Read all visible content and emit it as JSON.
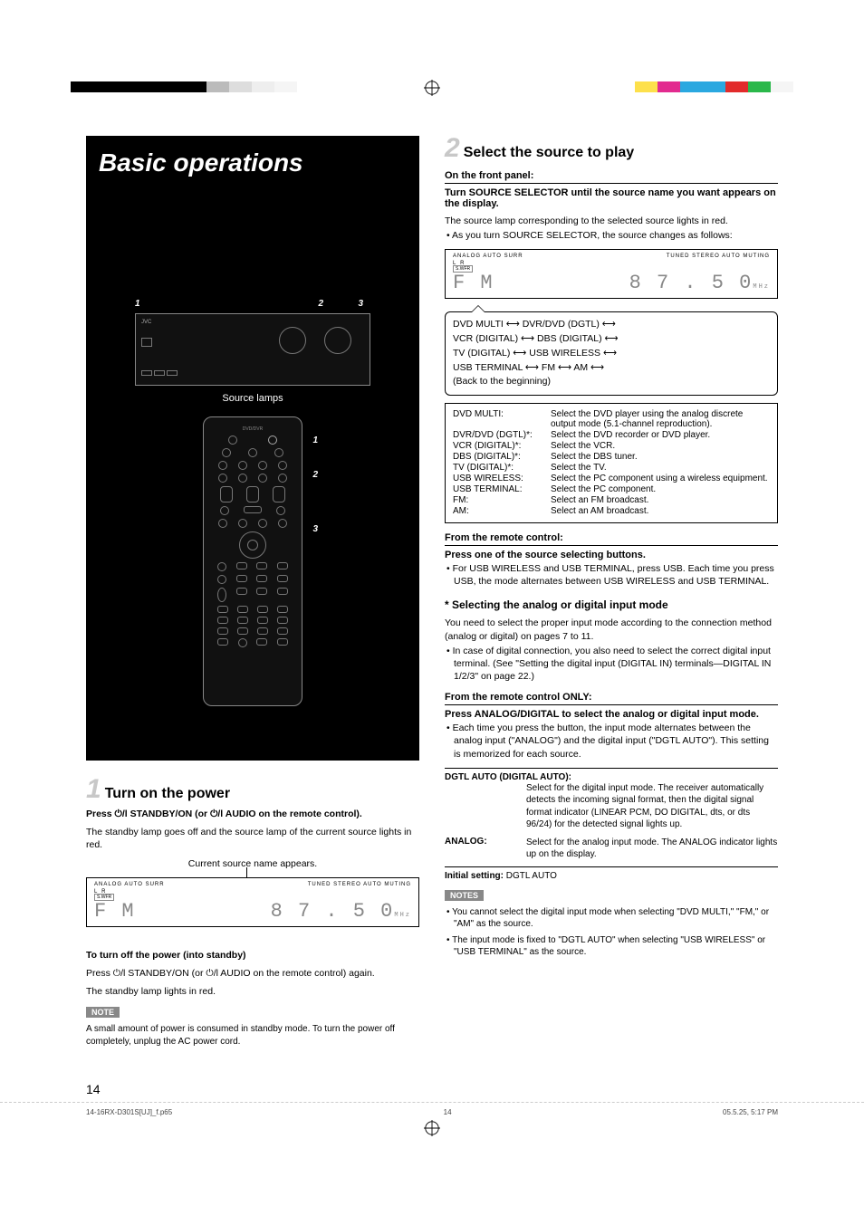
{
  "page_number": "14",
  "banner": {
    "title": "Basic operations"
  },
  "left": {
    "source_lamps_label": "Source lamps",
    "callouts_top": [
      "1",
      "2",
      "3"
    ],
    "callouts_remote": [
      "1",
      "2",
      "3"
    ],
    "step1": {
      "num": "1",
      "title": "Turn on the power",
      "instruction_prefix": "Press ",
      "instruction_mid": " STANDBY/ON (or ",
      "instruction_suffix": " AUDIO on the remote control).",
      "body": "The standby lamp goes off and the source lamp of the current source lights in red.",
      "caption": "Current source name appears.",
      "display": {
        "indicators_left": "ANALOG    AUTO SURR",
        "indicators_right": "TUNED  STEREO  AUTO MUTING",
        "main_left": "F M",
        "main_right": "8 7 . 5 0",
        "unit": "MHz"
      },
      "off_head": "To turn off the power (into standby)",
      "off_body1_pre": "Press ",
      "off_body1_mid": " STANDBY/ON (or ",
      "off_body1_suf": " AUDIO on the remote control) again.",
      "off_body2": "The standby lamp lights in red.",
      "note_tag": "NOTE",
      "note_body": "A small amount of power is consumed in standby mode. To turn the power off completely, unplug the AC power cord."
    }
  },
  "right": {
    "step2": {
      "num": "2",
      "title": "Select the source to play",
      "head_a": "On the front panel:",
      "head_a_body": "Turn SOURCE SELECTOR until the source name you want appears on the display.",
      "body1": "The source lamp corresponding to the selected source lights in red.",
      "bullet1": "•  As you turn SOURCE SELECTOR, the source changes as follows:",
      "display": {
        "indicators_left": "ANALOG    AUTO SURR",
        "indicators_right": "TUNED  STEREO  AUTO MUTING",
        "main_left": "F M",
        "main_right": "8 7 . 5 0",
        "unit": "MHz"
      },
      "flow": [
        "DVD MULTI ⟷ DVR/DVD (DGTL) ⟷",
        "VCR (DIGITAL) ⟷ DBS (DIGITAL) ⟷",
        "TV (DIGITAL) ⟷ USB WIRELESS ⟷",
        "USB TERMINAL ⟷ FM ⟷ AM ⟷",
        "(Back to the beginning)"
      ],
      "sources": [
        {
          "k": "DVD MULTI:",
          "v": "Select the DVD player using the analog discrete output mode (5.1-channel reproduction)."
        },
        {
          "k": "DVR/DVD (DGTL)*:",
          "v": "Select the DVD recorder or DVD player."
        },
        {
          "k": "VCR (DIGITAL)*:",
          "v": "Select the VCR."
        },
        {
          "k": "DBS (DIGITAL)*:",
          "v": "Select the DBS tuner."
        },
        {
          "k": "TV (DIGITAL)*:",
          "v": "Select the TV."
        },
        {
          "k": "USB WIRELESS:",
          "v": "Select the PC component using a wireless equipment."
        },
        {
          "k": "USB TERMINAL:",
          "v": "Select the PC component."
        },
        {
          "k": "FM:",
          "v": "Select an FM broadcast."
        },
        {
          "k": "AM:",
          "v": "Select an AM broadcast."
        }
      ],
      "head_b": "From the remote control:",
      "head_b_body": "Press one of the source selecting buttons.",
      "bullet_b": "•  For USB WIRELESS and USB TERMINAL, press USB. Each time you press USB, the mode alternates between USB WIRELESS and USB TERMINAL.",
      "head_c": "*  Selecting the analog or digital input mode",
      "body_c1": "You need to select the proper input mode according to the connection method (analog or digital) on pages 7 to 11.",
      "bullet_c": "•  In case of digital connection, you also need to select the correct digital input terminal. (See \"Setting the digital input (DIGITAL IN) terminals—DIGITAL IN 1/2/3\" on page 22.)",
      "head_d": "From the remote control ONLY:",
      "head_d_body": "Press ANALOG/DIGITAL to select the analog or digital input mode.",
      "bullet_d": "•  Each time you press the button, the input mode alternates between the analog input (\"ANALOG\") and the digital input (\"DGTL AUTO\"). This setting is memorized for each source.",
      "modes_head": "DGTL AUTO (DIGITAL AUTO):",
      "modes": [
        {
          "k": "",
          "v": "Select for the digital input mode. The receiver automatically detects the incoming signal format, then the digital signal format indicator (LINEAR PCM, DO DIGITAL, dts, or dts 96/24) for the detected signal lights up."
        },
        {
          "k": "ANALOG:",
          "v": "Select for the analog input mode. The ANALOG indicator lights up on the display."
        }
      ],
      "initial_label": "Initial setting:",
      "initial_value": " DGTL AUTO",
      "notes_tag": "NOTES",
      "notes": [
        "•  You cannot select the digital input mode when selecting \"DVD MULTI,\" \"FM,\" or \"AM\" as the source.",
        "•  The input mode is fixed to \"DGTL AUTO\" when selecting \"USB WIRELESS\" or \"USB TERMINAL\" as the source."
      ]
    }
  },
  "footer": {
    "file": "14-16RX-D301S[UJ]_f.p65",
    "page": "14",
    "timestamp": "05.5.25, 5:17 PM"
  },
  "colorbar_left": [
    "#000",
    "#000",
    "#000",
    "#000",
    "#000",
    "#000",
    "#bbb",
    "#ddd",
    "#eee",
    "#f5f5f5"
  ],
  "colorbar_right": [
    "#fde04b",
    "#e22b8f",
    "#2aa8e0",
    "#2aa8e0",
    "#e22b2b",
    "#2ab84a",
    "#f5f5f5"
  ]
}
